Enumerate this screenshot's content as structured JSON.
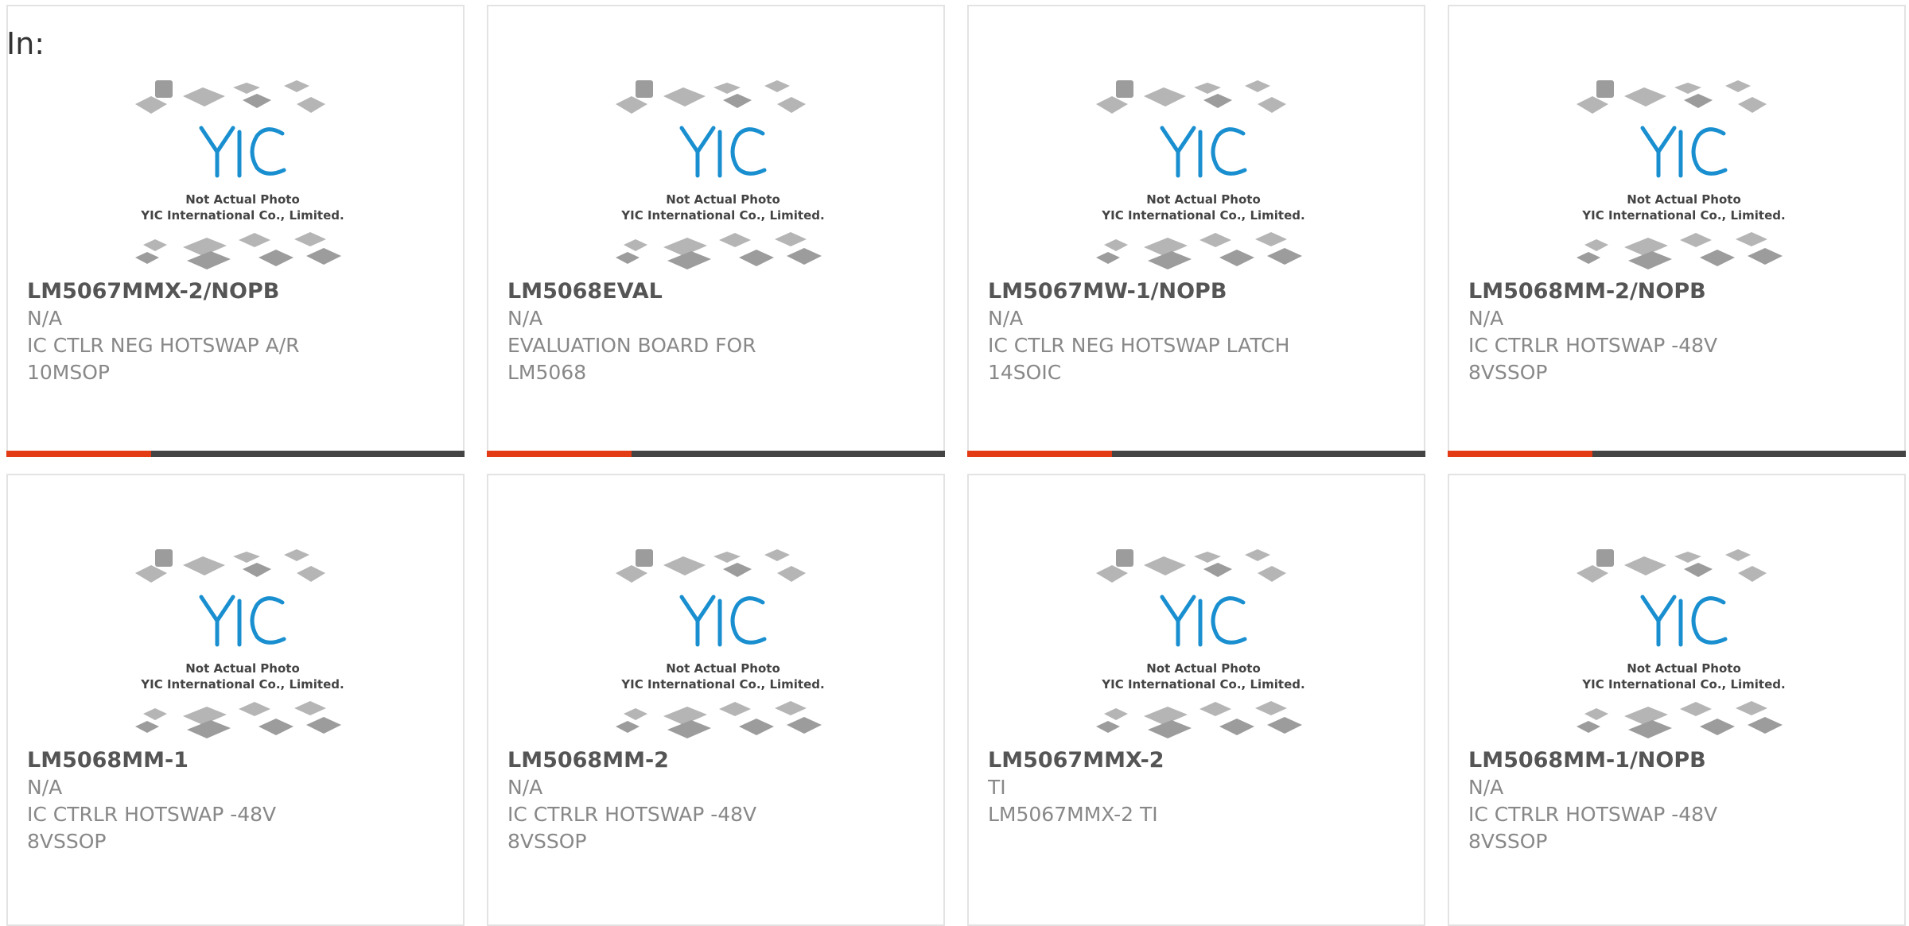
{
  "header": {
    "label": "In:"
  },
  "placeholder_image": {
    "logo_text": "YIC",
    "caption_line1": "Not Actual Photo",
    "caption_line2": "YIC International Co., Limited."
  },
  "colors": {
    "accent": "#e33b16",
    "bar": "#444444",
    "logo": "#1a8fd0"
  },
  "products": [
    {
      "part_number": "LM5067MMX-2/NOPB",
      "manufacturer": "N/A",
      "description": "IC CTLR NEG HOTSWAP A/R 10MSOP"
    },
    {
      "part_number": "LM5068EVAL",
      "manufacturer": "N/A",
      "description": "EVALUATION BOARD FOR LM5068"
    },
    {
      "part_number": "LM5067MW-1/NOPB",
      "manufacturer": "N/A",
      "description": "IC CTLR NEG HOTSWAP LATCH 14SOIC"
    },
    {
      "part_number": "LM5068MM-2/NOPB",
      "manufacturer": "N/A",
      "description": "IC CTRLR HOTSWAP -48V 8VSSOP"
    },
    {
      "part_number": "LM5068MM-1",
      "manufacturer": "N/A",
      "description": "IC CTRLR HOTSWAP -48V 8VSSOP"
    },
    {
      "part_number": "LM5068MM-2",
      "manufacturer": "N/A",
      "description": "IC CTRLR HOTSWAP -48V 8VSSOP"
    },
    {
      "part_number": "LM5067MMX-2",
      "manufacturer": "TI",
      "description": "LM5067MMX-2 TI"
    },
    {
      "part_number": "LM5068MM-1/NOPB",
      "manufacturer": "N/A",
      "description": "IC CTRLR HOTSWAP -48V 8VSSOP"
    }
  ]
}
